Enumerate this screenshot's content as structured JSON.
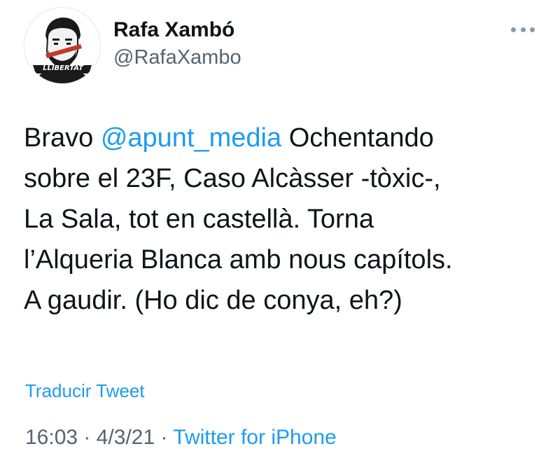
{
  "author": {
    "name": "Rafa Xambó",
    "handle": "@RafaXambo",
    "avatar_text": "LLIBERTAT"
  },
  "tweet": {
    "lines": [
      {
        "pre": "Bravo ",
        "mention": "@apunt_media",
        "post": " Ochentando"
      },
      {
        "text": "sobre el 23F, Caso Alcàsser -tòxic-,"
      },
      {
        "text": "La Sala, tot en castellà. Torna"
      },
      {
        "text": "l’Alqueria Blanca amb nous capítols."
      },
      {
        "text": "A gaudir. (Ho dic de conya, eh?)"
      }
    ]
  },
  "translate_label": "Traducir Tweet",
  "meta": {
    "time": "16:03",
    "sep1": " · ",
    "date": "4/3/21",
    "sep2": " · ",
    "source": "Twitter for iPhone"
  },
  "icons": {
    "more": "more-horizontal-icon"
  },
  "colors": {
    "link": "#1d9bf0",
    "secondary": "#536471",
    "text": "#0f1419",
    "avatar_band": "#c0392b"
  }
}
